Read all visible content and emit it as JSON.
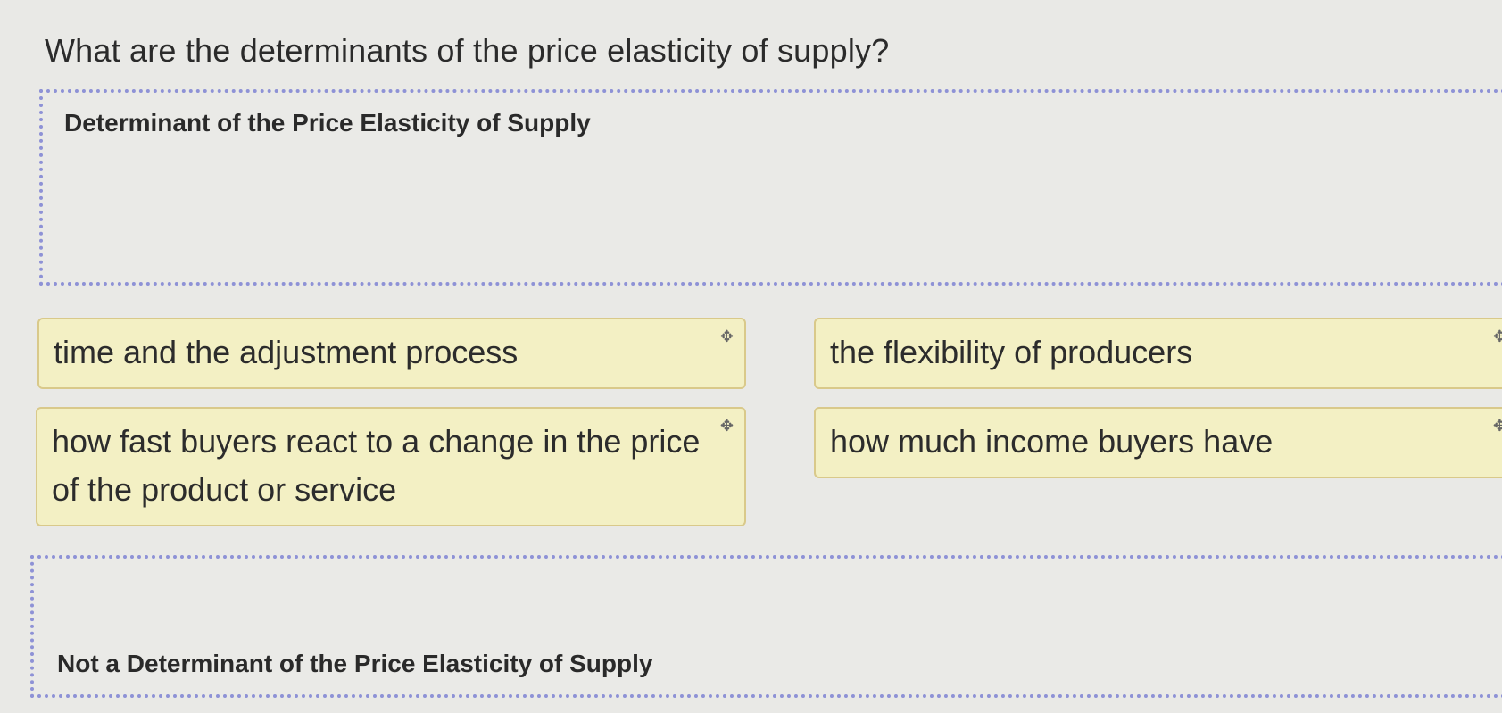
{
  "question": "What are the determinants of the price elasticity of supply?",
  "zones": {
    "determinant_label": "Determinant of the Price Elasticity of Supply",
    "not_determinant_label": "Not a Determinant of the Price Elasticity of Supply"
  },
  "cards": [
    {
      "text": "time and the adjustment process",
      "icon": "move-icon"
    },
    {
      "text": "the flexibility of producers",
      "icon": "move-icon"
    },
    {
      "text": "how fast buyers react to a change in the price of the product or service",
      "icon": "move-icon"
    },
    {
      "text": "how much income buyers have",
      "icon": "move-icon"
    }
  ],
  "colors": {
    "card_bg": "#f3f0c4",
    "card_border": "#d9c98a",
    "zone_border": "#8e92d6",
    "page_bg": "#e9e9e6"
  }
}
